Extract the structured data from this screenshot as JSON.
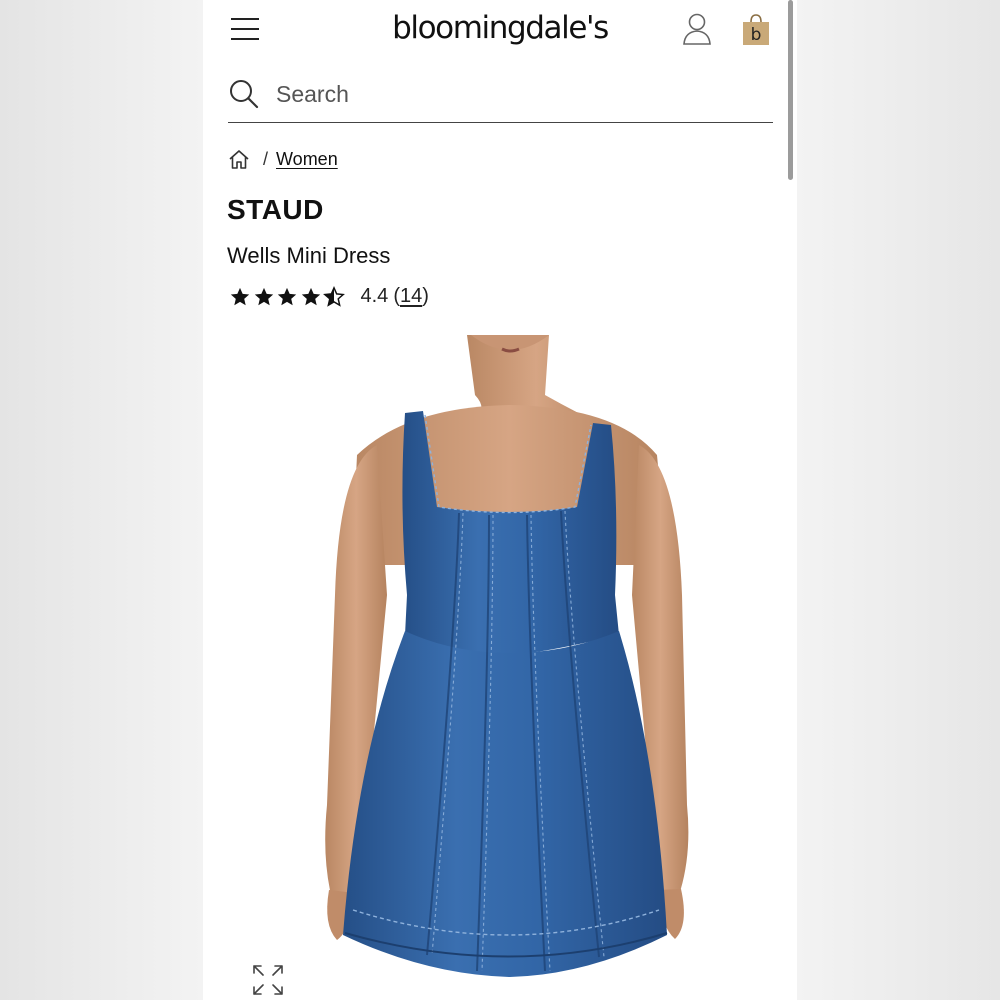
{
  "header": {
    "logo_text": "bloomingdale's",
    "menu_icon": "hamburger-menu-icon",
    "account_icon": "user-account-icon",
    "bag_icon": "shopping-bag-icon",
    "bag_letter": "b",
    "bag_color": "#c9a978"
  },
  "search": {
    "placeholder": "Search",
    "value": ""
  },
  "breadcrumb": {
    "home_icon": "home-icon",
    "separator": "/",
    "items": [
      {
        "label": "Women"
      }
    ]
  },
  "product": {
    "brand": "STAUD",
    "name": "Wells Mini Dress",
    "rating_value": "4.4",
    "review_count_open": "(",
    "review_count": "14",
    "review_count_close": ")",
    "stars_full": 4,
    "stars_half": 1,
    "image_alt": "Model wearing blue denim sleeveless mini dress",
    "dress_color": "#2f63a3",
    "expand_icon": "expand-arrows-icon"
  }
}
